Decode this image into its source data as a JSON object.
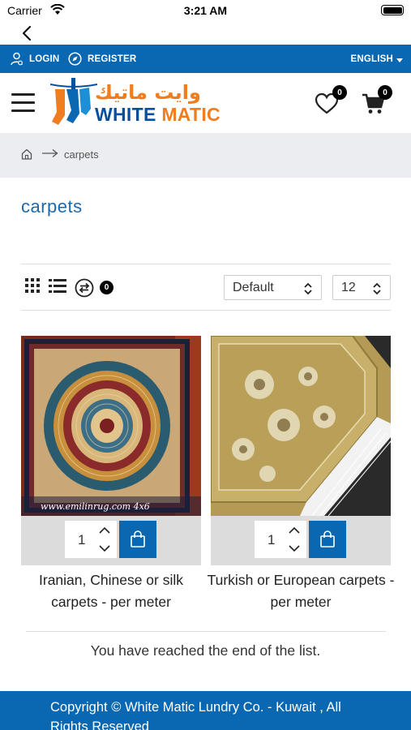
{
  "status_bar": {
    "carrier": "Carrier",
    "time": "3:21 AM"
  },
  "topbar": {
    "login_label": "LOGIN",
    "register_label": "REGISTER",
    "language_label": "ENGLISH",
    "background_color": "#0a67b1"
  },
  "header": {
    "logo_text_arabic": "وايت ماتيك",
    "logo_text_white": "WHITE",
    "logo_text_matic": "MATIC",
    "wishlist_count": "0",
    "cart_count": "0"
  },
  "breadcrumb": {
    "home_icon": "home-icon",
    "current": "carpets"
  },
  "page": {
    "title": "carpets"
  },
  "toolbar": {
    "compare_count": "0",
    "sort_value": "Default",
    "limit_value": "12"
  },
  "products": [
    {
      "name": "Iranian, Chinese or silk carpets - per meter",
      "quantity": "1",
      "image_watermark": "www.emilinrug.com 4x6"
    },
    {
      "name": "Turkish or European carpets - per meter",
      "quantity": "1"
    }
  ],
  "end_of_list": "You have reached the end of the list.",
  "footer": {
    "copyright": "Copyright © White Matic Lundry Co. - Kuwait , All Rights Reserved"
  },
  "colors": {
    "brand_blue": "#0a67b1",
    "brand_orange": "#f07d1e",
    "title_blue": "#1b6aae"
  }
}
